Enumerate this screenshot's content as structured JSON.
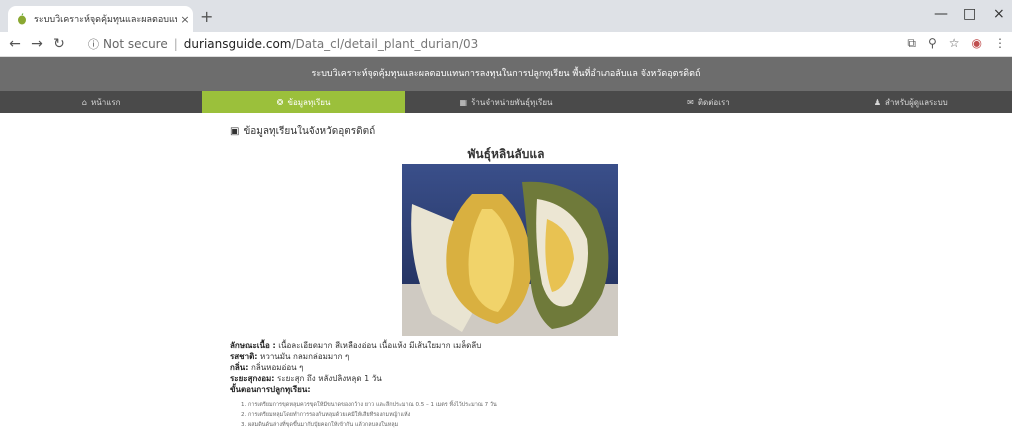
{
  "browser": {
    "tab_title": "ระบบวิเคราะห์จุดคุ้มทุนและผลตอบแท...",
    "tab_close": "×",
    "new_tab": "+",
    "window_buttons": [
      "—",
      "□",
      "×"
    ],
    "security_label": "Not secure",
    "url_host": "duriansguide.com",
    "url_path": "/Data_cl/detail_plant_durian/03"
  },
  "site": {
    "banner_title": "ระบบวิเคราะห์จุดคุ้มทุนและผลตอบแทนการลงทุนในการปลูกทุเรียน พื้นที่อำเภอลับแล จังหวัดอุตรดิตถ์",
    "menu": [
      {
        "label": "หน้าแรก",
        "icon": "home-icon"
      },
      {
        "label": "ข้อมูลทุเรียน",
        "icon": "durian-icon",
        "active": true
      },
      {
        "label": "ร้านจำหน่ายพันธุ์ทุเรียน",
        "icon": "store-icon"
      },
      {
        "label": "ติดต่อเรา",
        "icon": "chat-icon"
      },
      {
        "label": "สำหรับผู้ดูแลระบบ",
        "icon": "user-icon"
      }
    ],
    "accent_color": "#9bc03b"
  },
  "content": {
    "section_title": "ข้อมูลทุเรียนในจังหวัดอุตรดิตถ์",
    "heading": "พันธุ์หลินลับแล",
    "details": [
      {
        "label": "ลักษณะเนื้อ :",
        "value": "เนื้อละเอียดมาก สีเหลืองอ่อน เนื้อแห้ง มีเส้นใยมาก เมล็ดลีบ"
      },
      {
        "label": "รสชาติ:",
        "value": "หวานมัน กลมกล่อมมาก ๆ"
      },
      {
        "label": "กลิ่น:",
        "value": "กลิ่นหอมอ่อน ๆ"
      },
      {
        "label": "ระยะสุกงอม:",
        "value": "ระยะสุก ถึง หลังปลิงหลุด 1 วัน"
      }
    ],
    "steps_title": "ขั้นตอนการปลูกทุเรียน:",
    "steps": [
      "การเตรียมการขุดหลุมควรขุดให้มีขนาดของกว้าง ยาว และลึกประมาณ 0.5 – 1 เมตร ทิ้งไว้ประมาณ 7 วัน",
      "การเตรียมหลุมโดยทำการรองก้นหลุมด้วยเคมีให้เสียทีรองกมหญ้าแห้ง",
      "ผสมดินด้นล่างที่ขุดขึ้นมากับปุ๋ยคอกให้เข้ากัน แล้วกลบลงในหลุม"
    ]
  }
}
